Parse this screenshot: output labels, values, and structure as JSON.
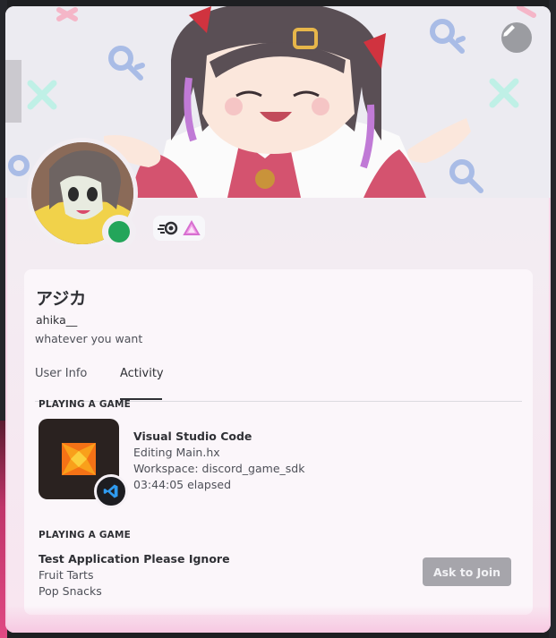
{
  "profile": {
    "display_name": "アジカ",
    "username": "ahika__",
    "bio": "whatever you want",
    "status": "online",
    "status_color": "#23a55a"
  },
  "banner": {
    "edit_icon": "pencil-icon"
  },
  "badges": [
    {
      "icon": "nitro-badge-icon"
    },
    {
      "icon": "boost-badge-icon"
    }
  ],
  "tabs": [
    {
      "label": "User Info",
      "active": false
    },
    {
      "label": "Activity",
      "active": true
    }
  ],
  "activities": [
    {
      "section": "PLAYING A GAME",
      "title": "Visual Studio Code",
      "details": "Editing Main.hx",
      "state": "Workspace: discord_game_sdk",
      "elapsed": "03:44:05 elapsed",
      "large_image": "haxe-logo-icon",
      "small_image": "vscode-icon"
    },
    {
      "section": "PLAYING A GAME",
      "title": "Test Application Please Ignore",
      "details": "Fruit Tarts",
      "state": "Pop Snacks",
      "button": "Ask to Join"
    }
  ]
}
